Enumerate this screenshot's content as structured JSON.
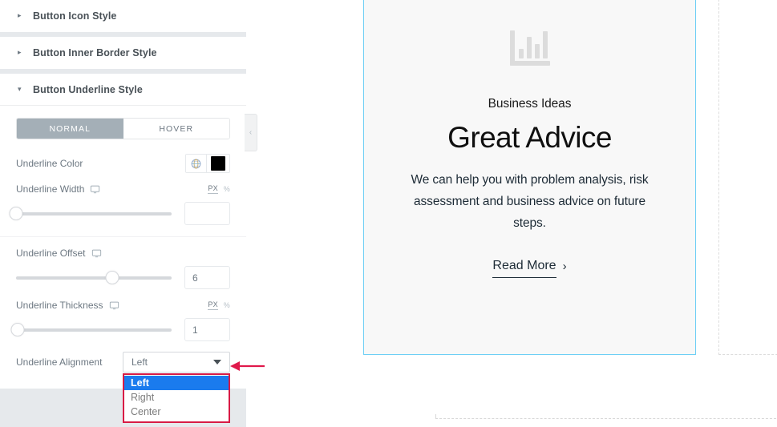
{
  "panel": {
    "sections": [
      {
        "title": "Button Icon Style",
        "state": "collapsed",
        "arrow": "chevron-right-icon"
      },
      {
        "title": "Button Inner Border Style",
        "state": "collapsed",
        "arrow": "chevron-right-icon"
      },
      {
        "title": "Button Underline Style",
        "state": "expanded",
        "arrow": "chevron-down-icon"
      }
    ],
    "collapse_handle": {
      "icon": "chevron-left-icon",
      "glyph": "‹"
    },
    "state_tabs": [
      {
        "label": "NORMAL",
        "active": true
      },
      {
        "label": "HOVER",
        "active": false
      }
    ],
    "controls": {
      "underline_color": {
        "label": "Underline Color",
        "global_icon": "globe-icon",
        "swatch_color": "#000000"
      },
      "underline_width": {
        "label": "Underline Width",
        "device_icon": "desktop-icon",
        "units": [
          {
            "label": "PX",
            "active": true
          },
          {
            "label": "%",
            "active": false
          }
        ],
        "value": "",
        "slider_percent": 0
      },
      "underline_offset": {
        "label": "Underline Offset",
        "device_icon": "desktop-icon",
        "units": [],
        "value": "6",
        "slider_percent": 62
      },
      "underline_thickness": {
        "label": "Underline Thickness",
        "device_icon": "desktop-icon",
        "units": [
          {
            "label": "PX",
            "active": true
          },
          {
            "label": "%",
            "active": false
          }
        ],
        "value": "1",
        "slider_percent": 1
      },
      "underline_alignment": {
        "label": "Underline Alignment",
        "selected": "Left",
        "caret_icon": "caret-down-icon",
        "open": true,
        "options": [
          {
            "label": "Left",
            "selected": true
          },
          {
            "label": "Right",
            "selected": false
          },
          {
            "label": "Center",
            "selected": false
          }
        ]
      }
    }
  },
  "annotations": {
    "arrow": {
      "name": "red-pointer-arrow",
      "color": "#e0194b",
      "direction": "left"
    },
    "highlight_box_color": "#d81b45"
  },
  "preview": {
    "card": {
      "icon": "bar-chart-icon",
      "eyebrow": "Business Ideas",
      "title": "Great Advice",
      "description": "We can help you with problem analysis, risk assessment and business advice on future steps.",
      "button": {
        "label": "Read More",
        "arrow_icon": "chevron-right-icon",
        "arrow_glyph": "›"
      },
      "border_color": "#6ecff5",
      "background": "#f8f8f8"
    }
  }
}
